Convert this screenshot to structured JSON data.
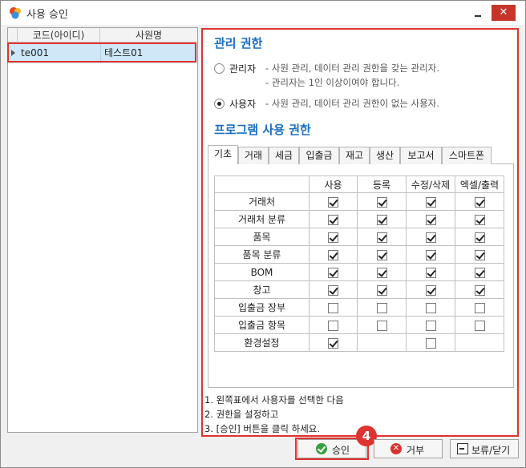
{
  "window": {
    "title": "사용 승인",
    "close_label": "✕"
  },
  "user_grid": {
    "columns": [
      "코드(아이디)",
      "사원명"
    ],
    "rows": [
      {
        "code": "te001",
        "name": "테스트01"
      }
    ]
  },
  "rights": {
    "title": "관리 권한",
    "admin": {
      "label": "관리자",
      "desc1": "- 사원 관리, 데이터 관리 권한을 갖는 관리자.",
      "desc2": "- 관리자는 1인 이상이여야 합니다.",
      "selected": false
    },
    "user": {
      "label": "사용자",
      "desc1": "- 사원 관리, 데이터 관리 권한이 없는 사용자.",
      "selected": true
    }
  },
  "program": {
    "title": "프로그램 사용 권한",
    "tabs": [
      "기초",
      "거래",
      "세금",
      "입출금",
      "재고",
      "생산",
      "보고서",
      "스마트폰"
    ],
    "active_tab": "기초",
    "columns": [
      "",
      "사용",
      "등록",
      "수정/삭제",
      "엑셀/출력"
    ],
    "rows": [
      {
        "name": "거래처",
        "perms": [
          true,
          true,
          true,
          true
        ]
      },
      {
        "name": "거래처 분류",
        "perms": [
          true,
          true,
          true,
          true
        ]
      },
      {
        "name": "품목",
        "perms": [
          true,
          true,
          true,
          true
        ]
      },
      {
        "name": "품목 분류",
        "perms": [
          true,
          true,
          true,
          true
        ]
      },
      {
        "name": "BOM",
        "perms": [
          true,
          true,
          true,
          true
        ]
      },
      {
        "name": "창고",
        "perms": [
          true,
          true,
          true,
          true
        ]
      },
      {
        "name": "입출금 장부",
        "perms": [
          false,
          false,
          false,
          false
        ]
      },
      {
        "name": "입출금 항목",
        "perms": [
          false,
          false,
          false,
          false
        ]
      },
      {
        "name": "환경설정",
        "perms": [
          true,
          null,
          false,
          null
        ]
      }
    ]
  },
  "help": [
    "1. 왼쪽표에서 사용자를 선택한 다음",
    "2. 권한을 설정하고",
    "3. [승인] 버튼을 클릭 하세요."
  ],
  "buttons": {
    "approve": "승인",
    "reject": "거부",
    "hold_close": "보류/닫기"
  },
  "step_badge": "4",
  "colors": {
    "accent": "#1a6fc4",
    "highlight": "#e0322e",
    "selected_row": "#cfe8f8"
  }
}
